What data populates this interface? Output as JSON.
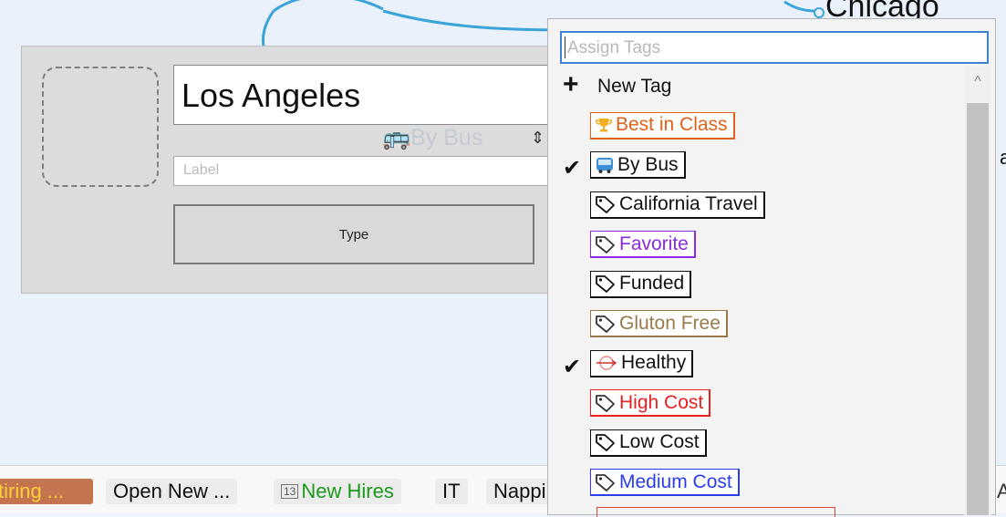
{
  "background": {
    "node_label": "Chicago"
  },
  "editor": {
    "name_value": "Los Angeles",
    "label_placeholder": "Label",
    "type_label": "Type",
    "ghost_tag": "By Bus"
  },
  "bottom_bar": {
    "chips": [
      {
        "label": "tiring ...",
        "color": "#ffd23a",
        "bg": "#c4744e"
      },
      {
        "label": "Open New ...",
        "color": "#111111"
      },
      {
        "label": "New Hires",
        "color": "#1a9a1a"
      },
      {
        "label": "IT",
        "color": "#111111"
      },
      {
        "label": "Nappi",
        "color": "#111111"
      },
      {
        "label": "A",
        "color": "#333333"
      }
    ]
  },
  "dropdown": {
    "search_placeholder": "Assign Tags",
    "new_tag_label": "New Tag",
    "tags": [
      {
        "label": "Best in Class",
        "color": "#e0621a",
        "checked": false,
        "icon": "trophy-icon"
      },
      {
        "label": "By Bus",
        "color": "#111111",
        "checked": true,
        "icon": "bus-icon"
      },
      {
        "label": "California Travel",
        "color": "#111111",
        "checked": false,
        "icon": "tag-icon"
      },
      {
        "label": "Favorite",
        "color": "#8a2be2",
        "checked": false,
        "icon": "tag-icon"
      },
      {
        "label": "Funded",
        "color": "#111111",
        "checked": false,
        "icon": "tag-icon"
      },
      {
        "label": "Gluton Free",
        "color": "#9a7a4a",
        "checked": false,
        "icon": "tag-icon"
      },
      {
        "label": "Healthy",
        "color": "#111111",
        "checked": true,
        "icon": "arrow-target-icon"
      },
      {
        "label": "High Cost",
        "color": "#e82020",
        "checked": false,
        "icon": "tag-icon"
      },
      {
        "label": "Low Cost",
        "color": "#111111",
        "checked": false,
        "icon": "tag-icon"
      },
      {
        "label": "Medium Cost",
        "color": "#2a3ef0",
        "checked": false,
        "icon": "tag-icon"
      }
    ],
    "side_letter": "a"
  }
}
